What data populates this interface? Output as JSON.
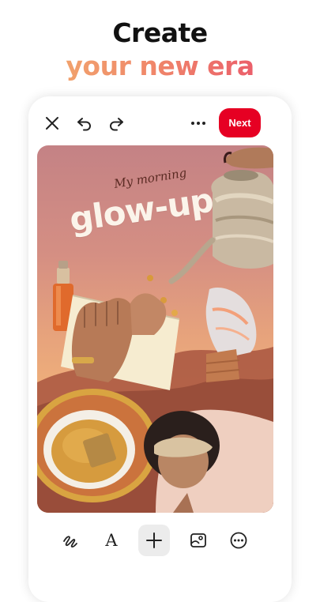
{
  "headline": {
    "line1": "Create",
    "line2": "your new era"
  },
  "editor": {
    "top_toolbar": {
      "close_icon": "close-icon",
      "undo_icon": "undo-icon",
      "redo_icon": "redo-icon",
      "more_icon": "more-horizontal-icon",
      "next_label": "Next"
    },
    "canvas": {
      "caption_small": "My morning",
      "caption_large": "glow-up"
    },
    "bottom_toolbar": {
      "draw_icon": "draw-squiggle-icon",
      "text_label": "A",
      "add_icon": "plus-icon",
      "image_icon": "image-icon",
      "more_icon": "more-circle-icon"
    }
  },
  "colors": {
    "accent": "#e60023",
    "headline_gradient": [
      "#f2b56f",
      "#f08a6a",
      "#e8456b"
    ],
    "canvas_background": [
      "#c48285",
      "#e7a37c",
      "#e39b6c"
    ]
  }
}
